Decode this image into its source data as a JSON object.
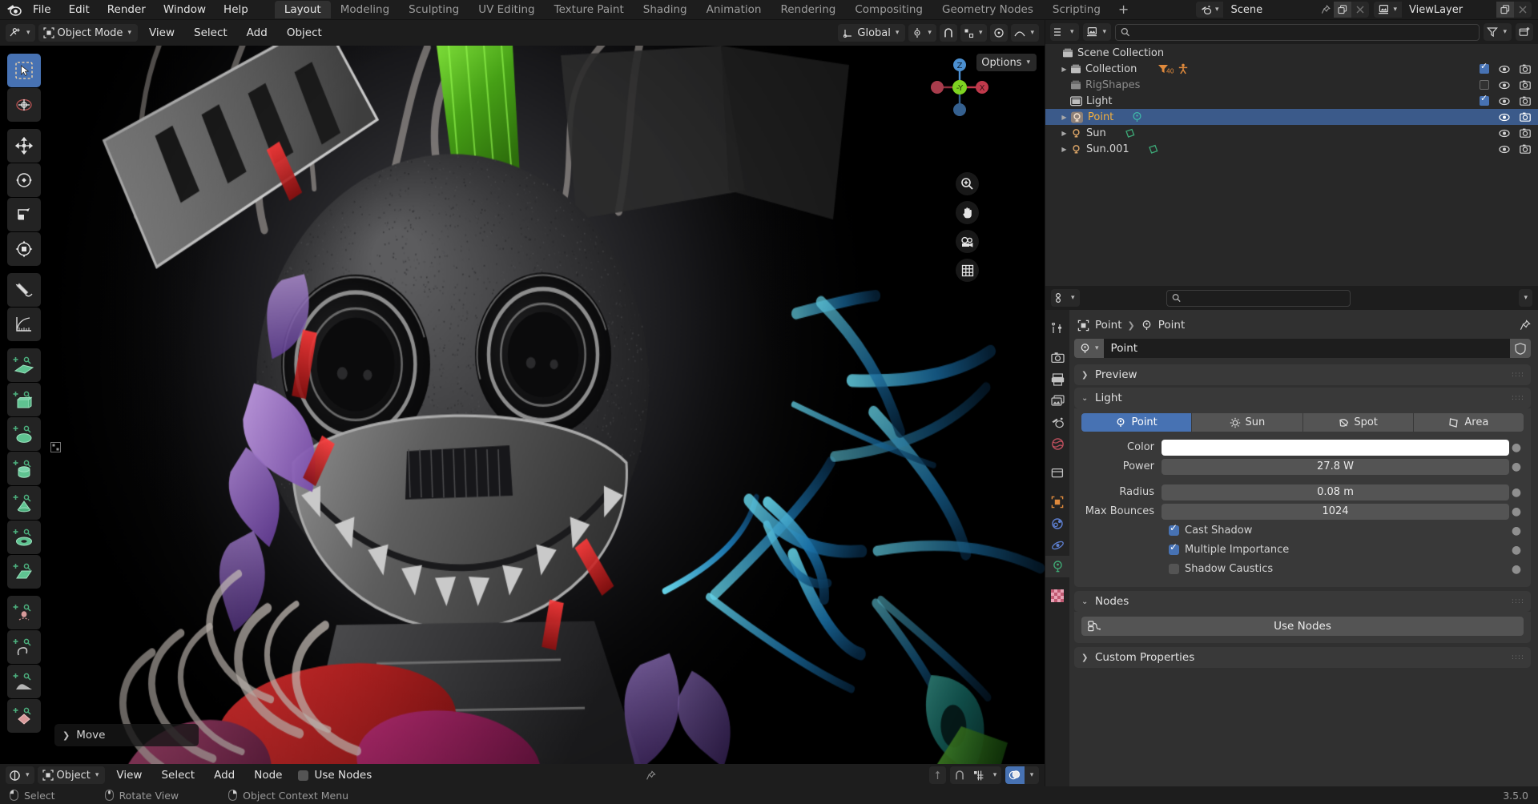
{
  "app": {
    "version": "3.5.0",
    "logo": "blender-logo"
  },
  "topbar": {
    "menus": [
      "File",
      "Edit",
      "Render",
      "Window",
      "Help"
    ],
    "workspaces": [
      {
        "label": "Layout",
        "active": true
      },
      {
        "label": "Modeling",
        "active": false
      },
      {
        "label": "Sculpting",
        "active": false
      },
      {
        "label": "UV Editing",
        "active": false
      },
      {
        "label": "Texture Paint",
        "active": false
      },
      {
        "label": "Shading",
        "active": false
      },
      {
        "label": "Animation",
        "active": false
      },
      {
        "label": "Rendering",
        "active": false
      },
      {
        "label": "Compositing",
        "active": false
      },
      {
        "label": "Geometry Nodes",
        "active": false
      },
      {
        "label": "Scripting",
        "active": false
      }
    ],
    "add_workspace": "+",
    "scene": {
      "name": "Scene",
      "icon": "scene-icon"
    },
    "view_layer": {
      "name": "ViewLayer",
      "icon": "view-layer-icon"
    }
  },
  "viewport": {
    "header": {
      "mode": "Object Mode",
      "menus": [
        "View",
        "Select",
        "Add",
        "Object"
      ],
      "transform_orientation": "Global",
      "options_label": "Options"
    },
    "gizmo": {
      "axes": [
        "Z",
        "X",
        "-Y"
      ]
    },
    "operator_panel": {
      "label": "Move"
    },
    "tools": [
      "tweak-select-tool",
      "cursor-tool",
      "move-tool",
      "rotate-tool",
      "scale-tool",
      "transform-tool",
      "annotate-tool",
      "measure-tool",
      "add-plane-tool",
      "add-cube-tool",
      "add-sphere-tool",
      "add-cylinder-tool",
      "add-cone-tool",
      "add-torus-tool",
      "add-grid-tool",
      "add-armature-tool",
      "add-curve-tool",
      "add-terrain-tool",
      "add-decal-tool"
    ]
  },
  "node_editor": {
    "editor_type": "shader-editor-icon",
    "shader_type": "Object",
    "menus": [
      "View",
      "Select",
      "Add",
      "Node"
    ],
    "use_nodes_label": "Use Nodes",
    "use_nodes_checked": false
  },
  "outliner": {
    "display_mode": "view-layer-icon",
    "search_placeholder": "",
    "search_value": "",
    "rows": [
      {
        "name": "Scene Collection",
        "icon": "collection-icon",
        "indent": 0,
        "arrow": false,
        "selected": false,
        "dim": false,
        "checkbox": null,
        "eye": false,
        "camera": false,
        "badges": []
      },
      {
        "name": "Collection",
        "icon": "collection-icon",
        "indent": 1,
        "arrow": true,
        "selected": false,
        "dim": false,
        "checkbox": true,
        "eye": true,
        "camera": true,
        "badges": [
          "filter-40",
          "armature-icon"
        ]
      },
      {
        "name": "RigShapes",
        "icon": "collection-icon",
        "indent": 1,
        "arrow": false,
        "selected": false,
        "dim": true,
        "checkbox": false,
        "eye": true,
        "camera": true,
        "badges": []
      },
      {
        "name": "Light",
        "icon": "collection-icon",
        "indent": 1,
        "arrow": false,
        "selected": false,
        "dim": false,
        "checkbox": true,
        "eye": true,
        "camera": true,
        "badges": []
      },
      {
        "name": "Point",
        "icon": "light-point-icon",
        "indent": 2,
        "arrow": true,
        "selected": true,
        "dim": false,
        "checkbox": null,
        "eye": true,
        "camera": true,
        "badges": [
          "light-data-icon"
        ]
      },
      {
        "name": "Sun",
        "icon": "light-sun-icon",
        "indent": 2,
        "arrow": true,
        "selected": false,
        "dim": false,
        "checkbox": null,
        "eye": true,
        "camera": true,
        "badges": [
          "light-data-icon"
        ]
      },
      {
        "name": "Sun.001",
        "icon": "light-sun-icon",
        "indent": 2,
        "arrow": true,
        "selected": false,
        "dim": false,
        "checkbox": null,
        "eye": true,
        "camera": true,
        "badges": [
          "light-data-icon"
        ]
      }
    ]
  },
  "properties": {
    "search_value": "",
    "tabs": [
      {
        "name": "tool",
        "icon": "tool-icon",
        "active": false
      },
      {
        "name": "render",
        "icon": "render-icon",
        "active": false
      },
      {
        "name": "output",
        "icon": "printer-icon",
        "active": false
      },
      {
        "name": "view-layer",
        "icon": "images-icon",
        "active": false
      },
      {
        "name": "scene",
        "icon": "scene-icon",
        "active": false
      },
      {
        "name": "world",
        "icon": "world-icon",
        "active": false
      },
      {
        "name": "collection",
        "icon": "collection-icon",
        "active": false
      },
      {
        "name": "object",
        "icon": "object-icon",
        "active": false
      },
      {
        "name": "modifiers",
        "icon": "wrench-icon",
        "active": false
      },
      {
        "name": "physics",
        "icon": "physics-icon",
        "active": false
      },
      {
        "name": "object-data",
        "icon": "light-data-icon",
        "active": true
      },
      {
        "name": "texture",
        "icon": "checker-icon",
        "active": false
      }
    ],
    "breadcrumb": {
      "object": "Point",
      "data": "Point"
    },
    "id_name": "Point",
    "panels": {
      "preview": {
        "label": "Preview",
        "expanded": false
      },
      "light": {
        "label": "Light",
        "expanded": true,
        "types": [
          {
            "label": "Point",
            "active": true
          },
          {
            "label": "Sun",
            "active": false
          },
          {
            "label": "Spot",
            "active": false
          },
          {
            "label": "Area",
            "active": false
          }
        ],
        "fields": [
          {
            "label": "Color",
            "value": "",
            "type": "color",
            "color": "#ffffff"
          },
          {
            "label": "Power",
            "value": "27.8 W",
            "type": "text"
          },
          {
            "label": "Radius",
            "value": "0.08 m",
            "type": "text"
          },
          {
            "label": "Max Bounces",
            "value": "1024",
            "type": "text"
          }
        ],
        "checkboxes": [
          {
            "label": "Cast Shadow",
            "checked": true
          },
          {
            "label": "Multiple Importance",
            "checked": true
          },
          {
            "label": "Shadow Caustics",
            "checked": false
          }
        ]
      },
      "nodes": {
        "label": "Nodes",
        "expanded": true,
        "button": "Use Nodes"
      },
      "custom_properties": {
        "label": "Custom Properties",
        "expanded": false
      }
    }
  },
  "statusbar": {
    "items": [
      {
        "icon": "mouse-left-icon",
        "label": "Select"
      },
      {
        "icon": "mouse-middle-icon",
        "label": "Rotate View"
      },
      {
        "icon": "mouse-right-icon",
        "label": "Object Context Menu"
      }
    ],
    "version": "3.5.0"
  },
  "colors": {
    "accent": "#4772b3",
    "selected_text": "#f3af3d",
    "bg_dark": "#1d1d1d",
    "bg_panel": "#303030",
    "bg_field": "#545454"
  }
}
